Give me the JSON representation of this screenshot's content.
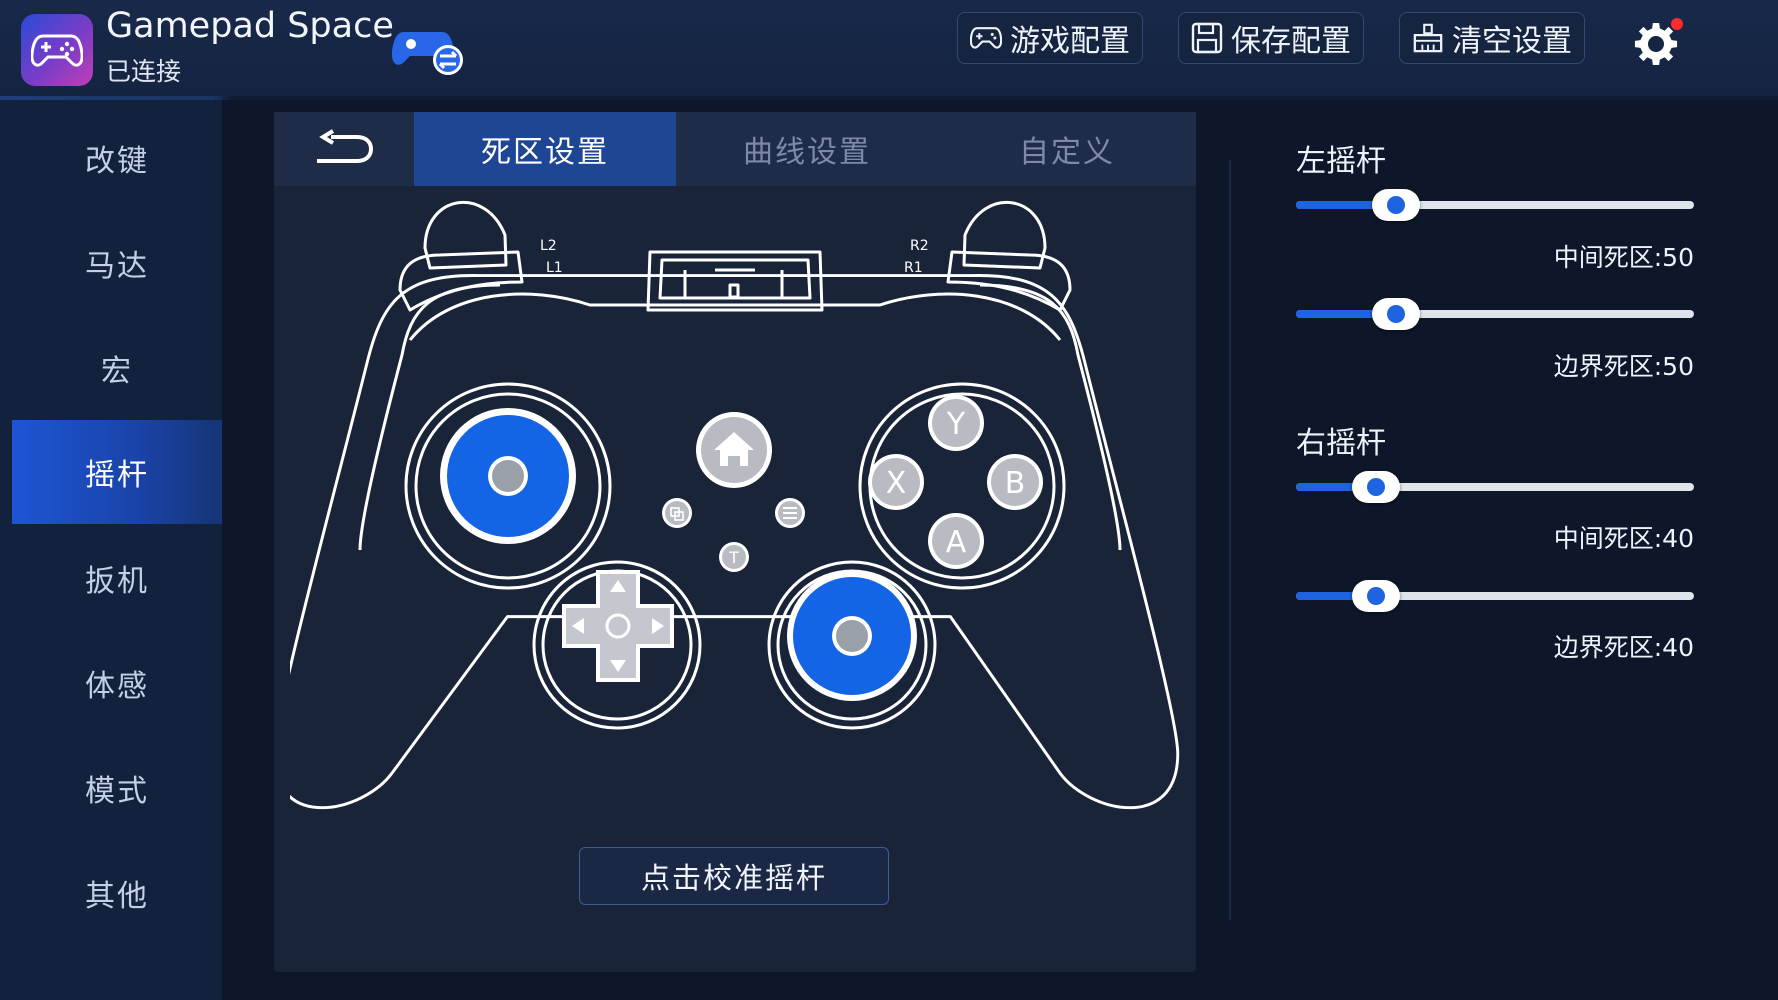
{
  "header": {
    "title": "Gamepad Space",
    "status": "已连接",
    "buttons": {
      "game_config": "游戏配置",
      "save_config": "保存配置",
      "clear_settings": "清空设置"
    },
    "settings_icon": "gear-icon",
    "notification_dot_color": "#ff2a2a"
  },
  "sidebar": {
    "items": [
      {
        "label": "改键"
      },
      {
        "label": "马达"
      },
      {
        "label": "宏"
      },
      {
        "label": "摇杆",
        "active": true
      },
      {
        "label": "扳机"
      },
      {
        "label": "体感"
      },
      {
        "label": "模式"
      },
      {
        "label": "其他"
      }
    ]
  },
  "tabs": {
    "back_icon": "back-arrow-icon",
    "items": [
      {
        "label": "死区设置",
        "active": true
      },
      {
        "label": "曲线设置"
      },
      {
        "label": "自定义"
      }
    ]
  },
  "controller": {
    "buttons": {
      "y": "Y",
      "x": "X",
      "b": "B",
      "a": "A",
      "l1": "L1",
      "l2": "L2",
      "r1": "R1",
      "r2": "R2",
      "t": "T"
    },
    "highlight_color": "#1464e6"
  },
  "calibrate_button": "点击校准摇杆",
  "left_stick": {
    "title": "左摇杆",
    "center_deadzone": {
      "label": "中间死区:50",
      "value": 50
    },
    "edge_deadzone": {
      "label": "边界死区:50",
      "value": 50
    }
  },
  "right_stick": {
    "title": "右摇杆",
    "center_deadzone": {
      "label": "中间死区:40",
      "value": 40
    },
    "edge_deadzone": {
      "label": "边界死区:40",
      "value": 40
    }
  },
  "colors": {
    "accent": "#1e63e0",
    "background": "#0d1729",
    "panel": "#1a2438"
  }
}
